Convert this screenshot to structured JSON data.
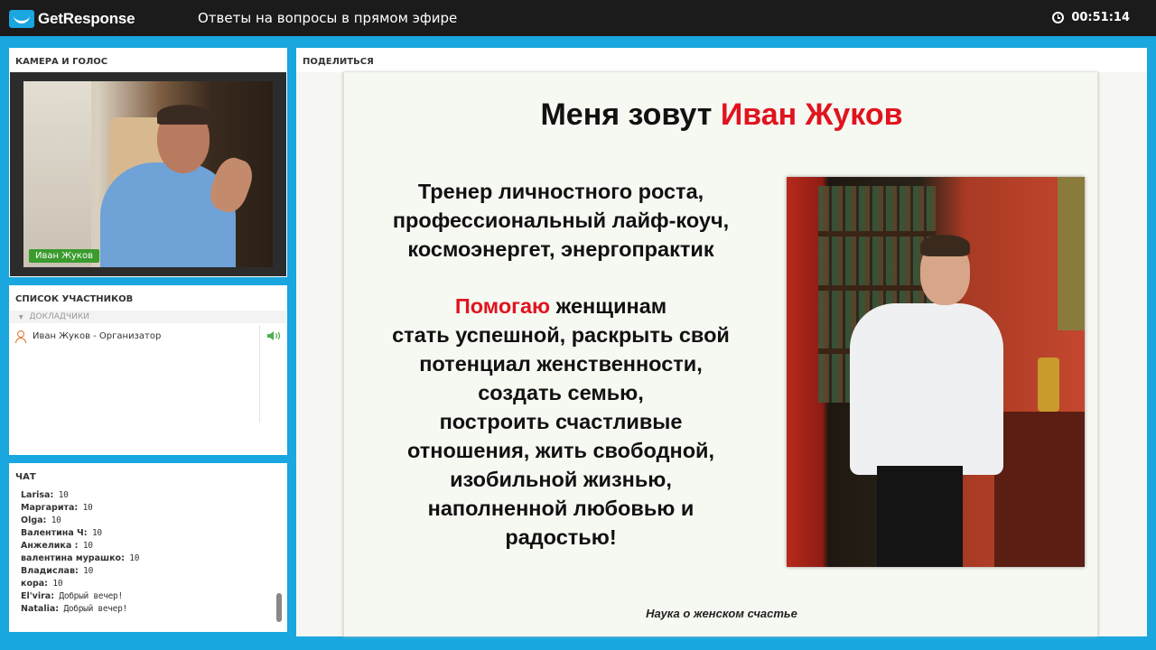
{
  "app": {
    "brand": "GetResponse",
    "title": "Ответы на вопросы в прямом эфире",
    "timer": "00:51:14"
  },
  "camera": {
    "header": "КАМЕРА И ГОЛОС",
    "presenter_name": "Иван Жуков"
  },
  "participants": {
    "header": "СПИСОК УЧАСТНИКОВ",
    "group_label": "ДОКЛАДЧИКИ",
    "items": [
      {
        "name": "Иван Жуков - Организатор"
      }
    ]
  },
  "chat": {
    "header": "ЧАТ",
    "messages": [
      {
        "author": "Larisa:",
        "text": " 10"
      },
      {
        "author": "Маргарита:",
        "text": " 10"
      },
      {
        "author": "Olga:",
        "text": " 10"
      },
      {
        "author": "Валентина Ч:",
        "text": " 10"
      },
      {
        "author": "Анжелика :",
        "text": " 10"
      },
      {
        "author": "валентина мурашко:",
        "text": " 10"
      },
      {
        "author": "Владислав:",
        "text": " 10"
      },
      {
        "author": "кора:",
        "text": " 10"
      },
      {
        "author": "El'vira:",
        "text": " Добрый вечер!"
      },
      {
        "author": "Natalia:",
        "text": " Добрый вечер!"
      }
    ]
  },
  "share": {
    "header": "ПОДЕЛИТЬСЯ",
    "slide": {
      "title_prefix": "Меня зовут ",
      "title_name": "Иван Жуков",
      "lines1": [
        "Тренер личностного роста,",
        "профессиональный лайф-коуч,",
        "космоэнергет, энергопрактик"
      ],
      "highlight": "Помогаю",
      "highlight_rest": " женщинам",
      "lines2": [
        "стать успешной, раскрыть свой",
        "потенциал женственности,",
        "создать семью,",
        "построить счастливые",
        "отношения, жить свободной,",
        "изобильной жизнью,",
        "наполненной любовью и",
        "радостью!"
      ],
      "caption": "Наука о женском счастье"
    }
  },
  "colors": {
    "accent": "#1aa6de",
    "topbar": "#1b1b1b",
    "name_tag": "#3b9b2e",
    "highlight_red": "#e0141e"
  }
}
